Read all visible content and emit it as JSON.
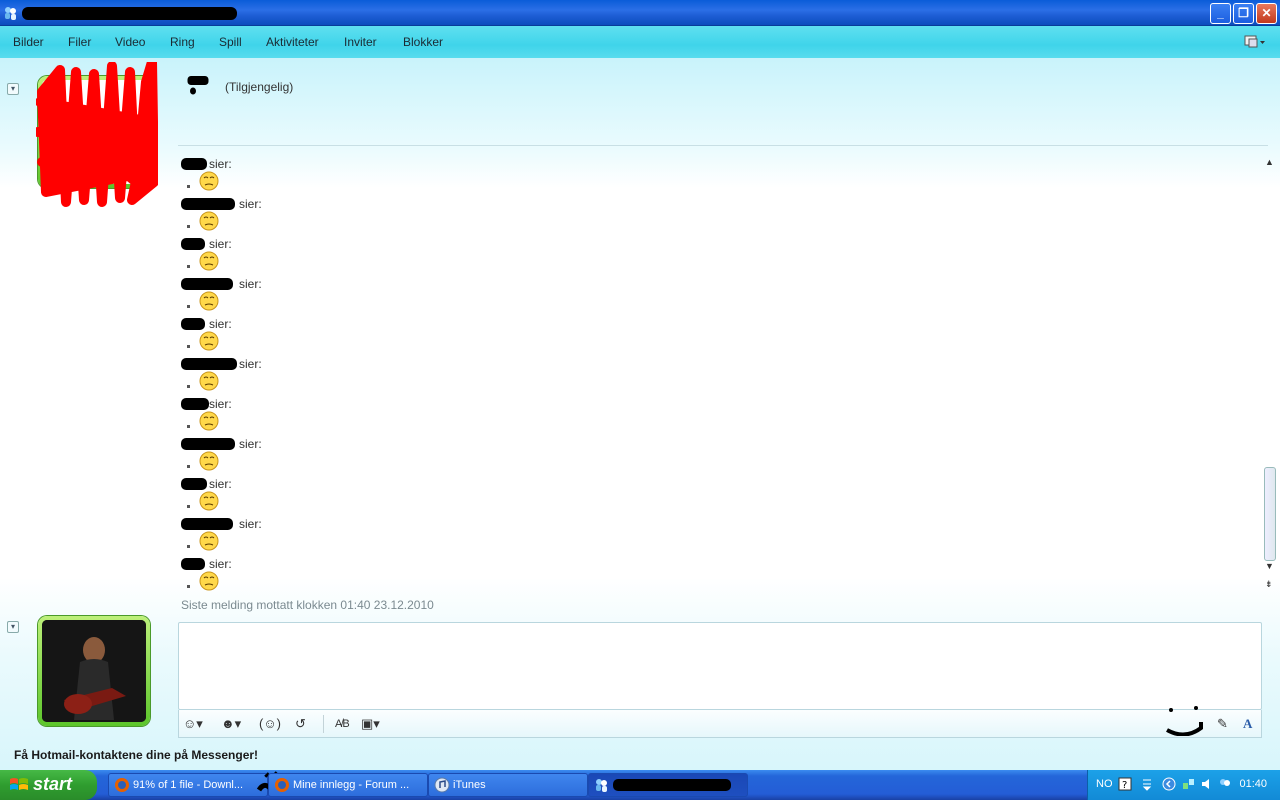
{
  "window": {
    "menu": [
      "Bilder",
      "Filer",
      "Video",
      "Ring",
      "Spill",
      "Aktiviteter",
      "Inviter",
      "Blokker"
    ]
  },
  "contact": {
    "status": "(Tilgjengelig)"
  },
  "conversation": {
    "says_label": "sier:",
    "message_count": 11,
    "last_message": "Siste melding mottatt klokken 01:40 23.12.2010"
  },
  "footer": {
    "promo": "Få Hotmail-kontaktene dine på Messenger!"
  },
  "taskbar": {
    "start_label": "start",
    "tasks": [
      {
        "label": "91% of 1 file - Downl..."
      },
      {
        "label": "Mine innlegg - Forum ..."
      },
      {
        "label": "iTunes"
      }
    ],
    "language": "NO",
    "clock": "01:40"
  },
  "colors": {
    "menubar": "#3fd4ea",
    "avatar_frame": "#5cc52b",
    "titlebar": "#1f5fd6",
    "taskbar": "#245dd6",
    "start_button": "#2f9d2f"
  }
}
